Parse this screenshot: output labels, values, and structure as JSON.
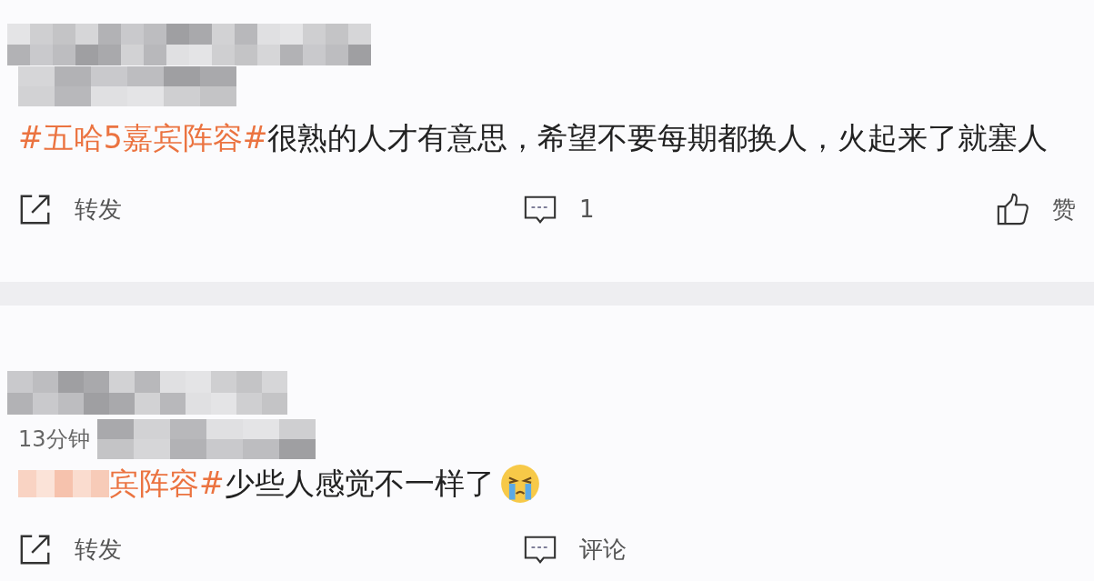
{
  "posts": [
    {
      "topic": "#五哈5嘉宾阵容#",
      "text": "很熟的人才有意思，希望不要每期都换人，火起来了就塞人",
      "actions": {
        "repost": "转发",
        "comment": "1",
        "like": "赞"
      }
    },
    {
      "time": "13分钟",
      "topic": "宾阵容#",
      "text": "少些人感觉不一样了",
      "emoji": true,
      "actions": {
        "repost": "转发",
        "comment": "评论"
      }
    }
  ]
}
